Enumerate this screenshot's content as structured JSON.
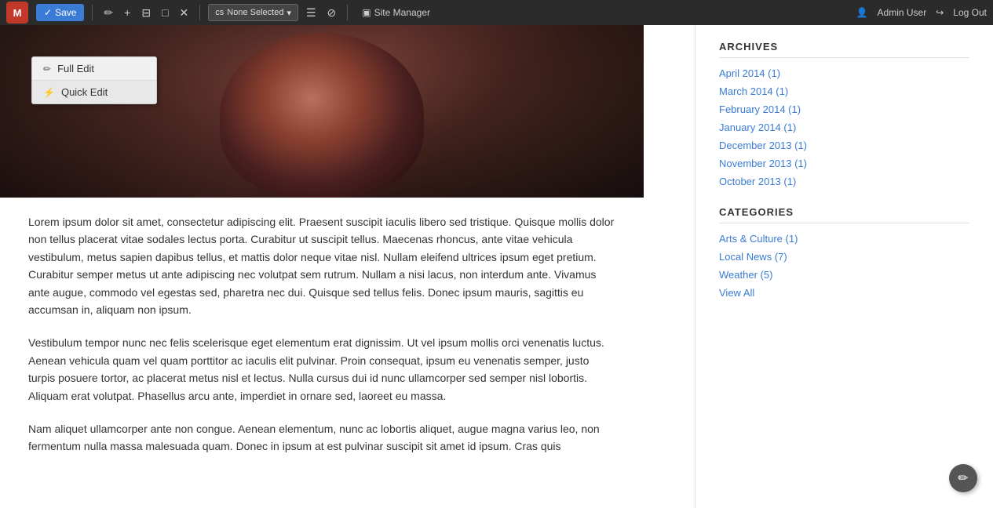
{
  "toolbar": {
    "save_label": "Save",
    "none_selected": "None Selected",
    "site_manager": "Site Manager",
    "admin_user": "Admin User",
    "log_out": "Log Out"
  },
  "edit_menu": {
    "full_edit_label": "Full Edit",
    "quick_edit_label": "Quick Edit"
  },
  "sidebar": {
    "archives_label": "ARCHIVES",
    "archives": [
      {
        "label": "April 2014 (1)"
      },
      {
        "label": "March 2014 (1)"
      },
      {
        "label": "February 2014 (1)"
      },
      {
        "label": "January 2014 (1)"
      },
      {
        "label": "December 2013 (1)"
      },
      {
        "label": "November 2013 (1)"
      },
      {
        "label": "October 2013 (1)"
      }
    ],
    "categories_label": "CATEGORIES",
    "categories": [
      {
        "label": "Arts & Culture (1)"
      },
      {
        "label": "Local News (7)"
      },
      {
        "label": "Weather (5)"
      },
      {
        "label": "View All"
      }
    ]
  },
  "article": {
    "paragraph1": "Lorem ipsum dolor sit amet, consectetur adipiscing elit. Praesent suscipit iaculis libero sed tristique. Quisque mollis dolor non tellus placerat vitae sodales lectus porta. Curabitur ut suscipit tellus. Maecenas rhoncus, ante vitae vehicula vestibulum, metus sapien dapibus tellus, et mattis dolor neque vitae nisl. Nullam eleifend ultrices ipsum eget pretium. Curabitur semper metus ut ante adipiscing nec volutpat sem rutrum. Nullam a nisi lacus, non interdum ante. Vivamus ante augue, commodo vel egestas sed, pharetra nec dui. Quisque sed tellus felis. Donec ipsum mauris, sagittis eu accumsan in, aliquam non ipsum.",
    "paragraph2": "Vestibulum tempor nunc nec felis scelerisque eget elementum erat dignissim. Ut vel ipsum mollis orci venenatis luctus. Aenean vehicula quam vel quam porttitor ac iaculis elit pulvinar. Proin consequat, ipsum eu venenatis semper, justo turpis posuere tortor, ac placerat metus nisl et lectus. Nulla cursus dui id nunc ullamcorper sed semper nisl lobortis. Aliquam erat volutpat. Phasellus arcu ante, imperdiet in ornare sed, laoreet eu massa.",
    "paragraph3": "Nam aliquet ullamcorper ante non congue. Aenean elementum, nunc ac lobortis aliquet, augue magna varius leo, non fermentum nulla massa malesuada quam. Donec in ipsum at est pulvinar suscipit sit amet id ipsum. Cras quis"
  },
  "colors": {
    "accent_blue": "#3a7bd5",
    "toolbar_bg": "#2b2b2b",
    "save_btn": "#3a7bd5"
  }
}
